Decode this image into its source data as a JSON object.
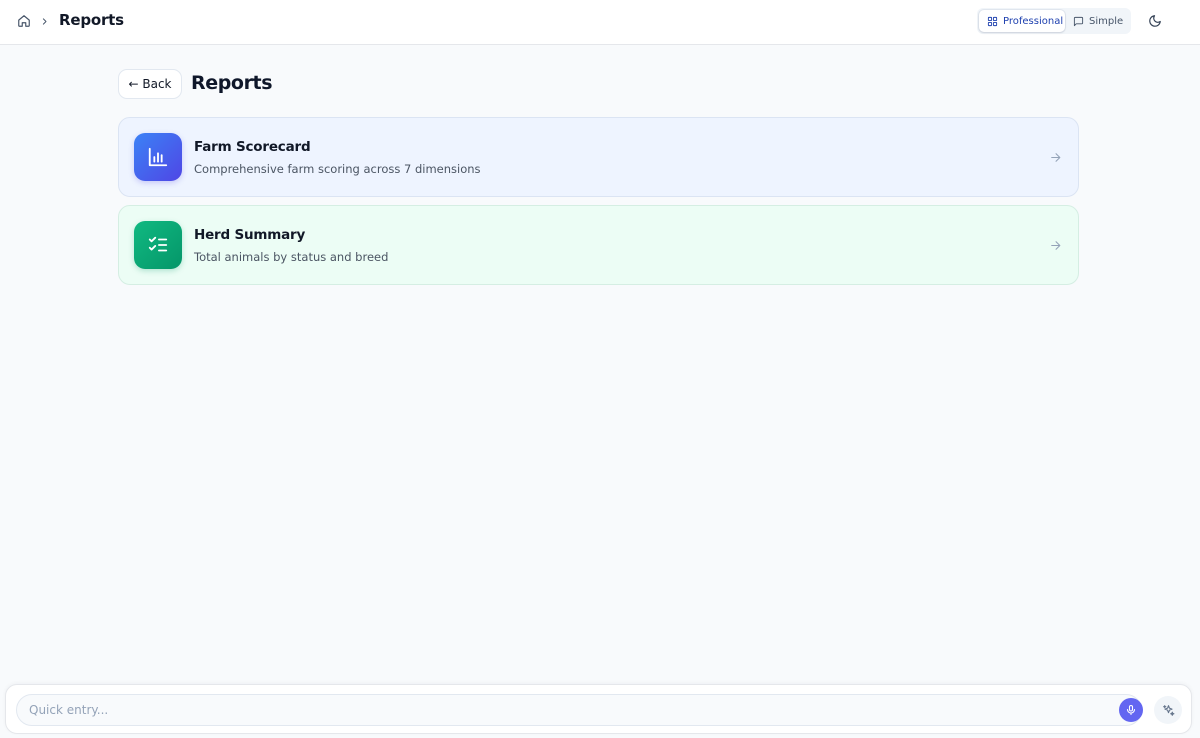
{
  "breadcrumb": {
    "home_icon": "home-icon",
    "separator_icon": "chevron-right-icon",
    "current": "Reports"
  },
  "mode_toggle": {
    "professional": {
      "label": "Professional",
      "icon": "grid-icon",
      "active": true
    },
    "simple": {
      "label": "Simple",
      "icon": "message-square-icon",
      "active": false
    }
  },
  "theme_toggle": {
    "icon": "moon-icon"
  },
  "header": {
    "back_label": "← Back",
    "title": "Reports"
  },
  "reports": [
    {
      "title": "Farm Scorecard",
      "description": "Comprehensive farm scoring across 7 dimensions",
      "icon": "bar-chart-icon",
      "color": "#4f46e5"
    },
    {
      "title": "Herd Summary",
      "description": "Total animals by status and breed",
      "icon": "list-checks-icon",
      "color": "#059669"
    }
  ],
  "quick_entry": {
    "placeholder": "Quick entry...",
    "mic_icon": "microphone-icon",
    "ai_icon": "sparkles-icon"
  },
  "colors": {
    "accent": "#6366f1",
    "background": "#f8fafc",
    "card_blue_bg": "#eef4ff",
    "card_green_bg": "#ecfdf5"
  }
}
